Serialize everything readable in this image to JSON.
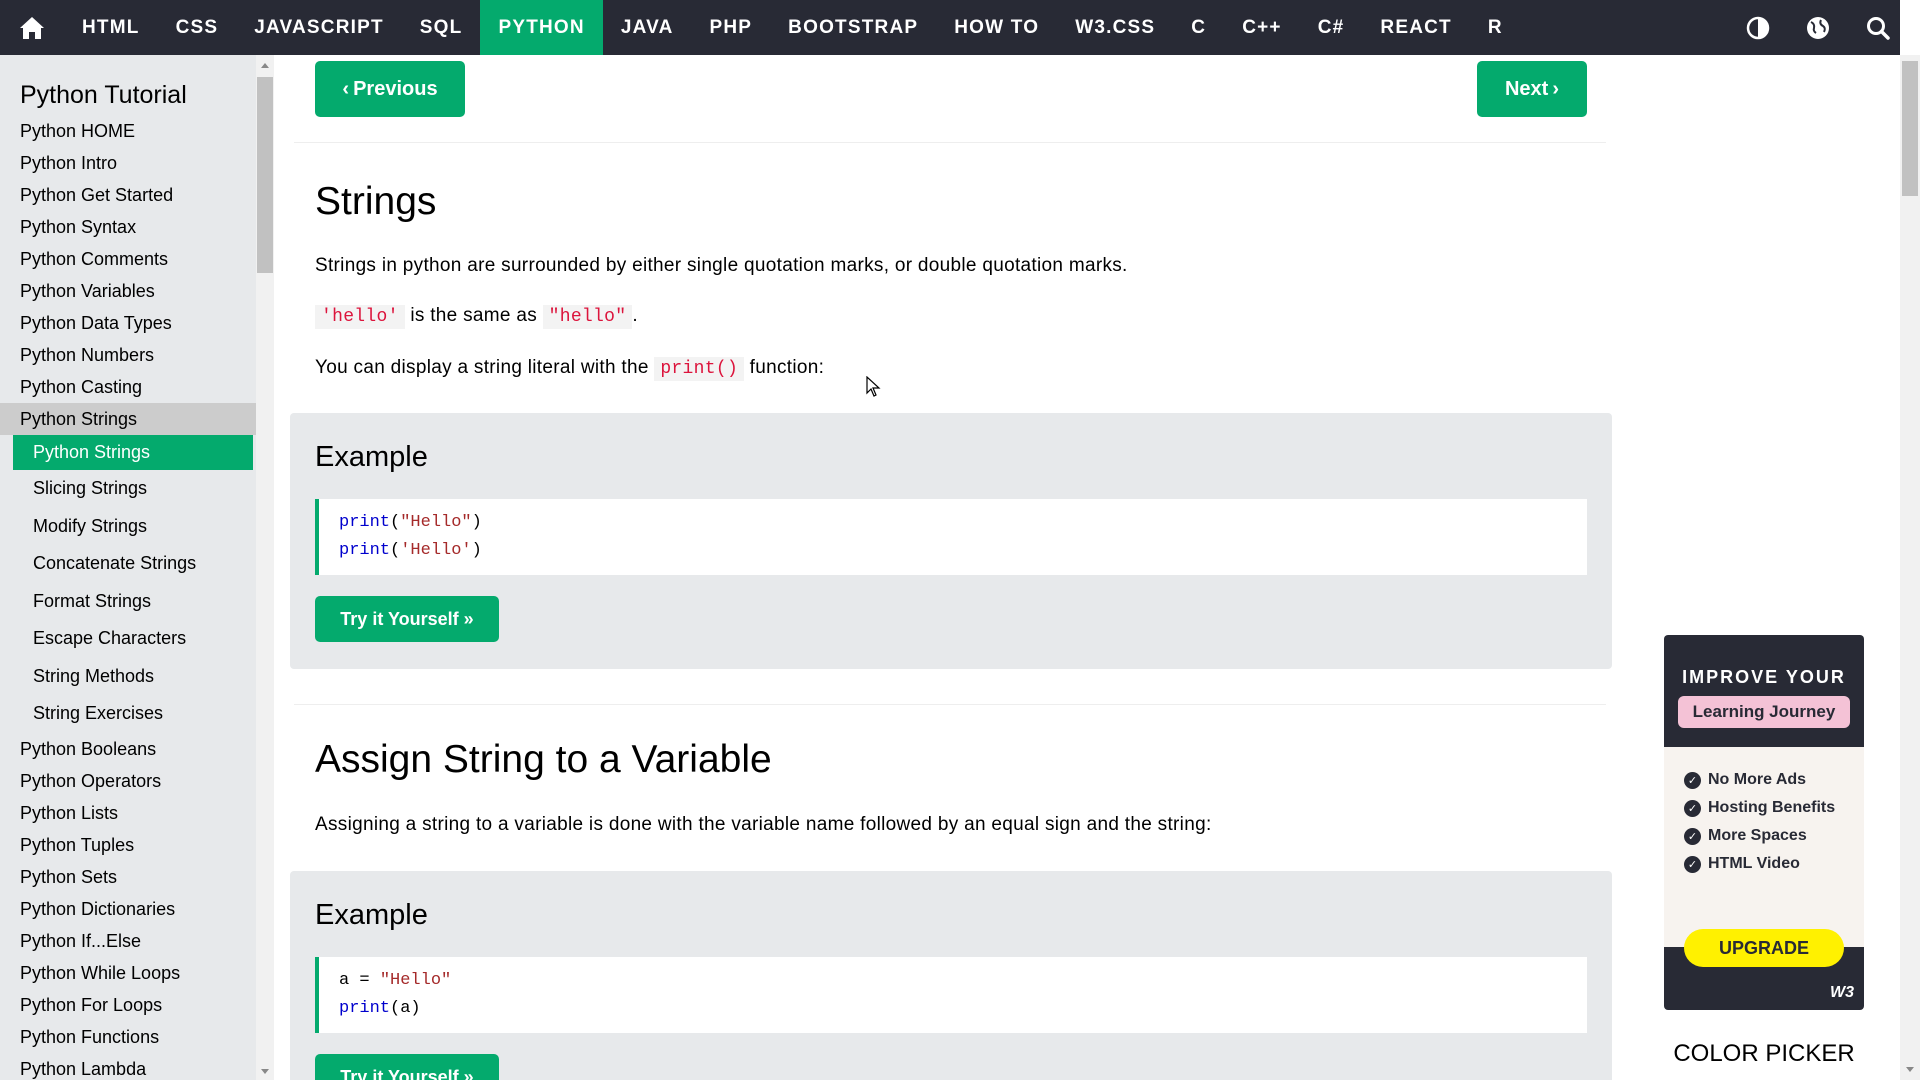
{
  "topnav": {
    "items": [
      "HTML",
      "CSS",
      "JAVASCRIPT",
      "SQL",
      "PYTHON",
      "JAVA",
      "PHP",
      "BOOTSTRAP",
      "HOW TO",
      "W3.CSS",
      "C",
      "C++",
      "C#",
      "REACT",
      "R"
    ],
    "active_index": 4,
    "icons": [
      "home-icon",
      "contrast-icon",
      "globe-icon",
      "search-icon"
    ]
  },
  "sidebar": {
    "title": "Python Tutorial",
    "items_before": [
      "Python HOME",
      "Python Intro",
      "Python Get Started",
      "Python Syntax",
      "Python Comments",
      "Python Variables",
      "Python Data Types",
      "Python Numbers",
      "Python Casting",
      "Python Strings"
    ],
    "sub_items": [
      "Python Strings",
      "Slicing Strings",
      "Modify Strings",
      "Concatenate Strings",
      "Format Strings",
      "Escape Characters",
      "String Methods",
      "String Exercises"
    ],
    "items_after": [
      "Python Booleans",
      "Python Operators",
      "Python Lists",
      "Python Tuples",
      "Python Sets",
      "Python Dictionaries",
      "Python If...Else",
      "Python While Loops",
      "Python For Loops",
      "Python Functions",
      "Python Lambda"
    ]
  },
  "main": {
    "prev_label": "Previous",
    "next_label": "Next",
    "h1_strings": "Strings",
    "p1": "Strings in python are surrounded by either single quotation marks, or double quotation marks.",
    "p2_code1": "'hello'",
    "p2_mid": "is the same as",
    "p2_code2": "\"hello\"",
    "p2_end": ".",
    "p3_start": "You can display a string literal with the",
    "p3_code": "print()",
    "p3_end": "function:",
    "example1": {
      "title": "Example",
      "lines": [
        {
          "fn": "print",
          "open": "(",
          "str": "\"Hello\"",
          "close": ")"
        },
        {
          "fn": "print",
          "open": "(",
          "str": "'Hello'",
          "close": ")"
        }
      ],
      "try_label": "Try it Yourself »"
    },
    "h1_assign": "Assign String to a Variable",
    "p4": "Assigning a string to a variable is done with the variable name followed by an equal sign and the string:",
    "example2": {
      "title": "Example",
      "line1_var": "a = ",
      "line1_str": "\"Hello\"",
      "line2_fn": "print",
      "line2_rest": "(a)",
      "try_label": "Try it Yourself »"
    }
  },
  "ad": {
    "top": "IMPROVE YOUR",
    "pink": "Learning Journey",
    "features": [
      "No More Ads",
      "Hosting Benefits",
      "More Spaces",
      "HTML Video"
    ],
    "upgrade": "UPGRADE",
    "logo": "W3"
  },
  "color_picker_label": "COLOR PICKER",
  "colors": {
    "nav_bg": "#282A35",
    "accent": "#04AA6D",
    "sidebar_bg": "#E7E9EB",
    "code_red": "#DC143C"
  }
}
